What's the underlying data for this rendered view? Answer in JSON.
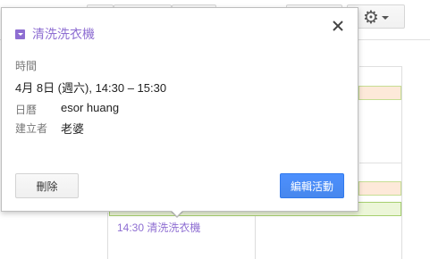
{
  "popup": {
    "event_title": "清洗洗衣機",
    "time_label": "時間",
    "time_value": "4月 8日 (週六), 14:30 – 15:30",
    "calendar_label": "日曆",
    "calendar_value": "esor huang",
    "creator_label": "建立者",
    "creator_value": "老婆",
    "delete_label": "刪除",
    "edit_label": "編輯活動",
    "close_icon": "close-icon",
    "event_color": "#8e6ed2"
  },
  "calendar_background": {
    "event_text": "14:30 清洗洗衣機",
    "settings_icon": "gear-icon"
  },
  "colors": {
    "accent_blue": "#4d90fe",
    "event_purple": "#8e6ed2"
  }
}
